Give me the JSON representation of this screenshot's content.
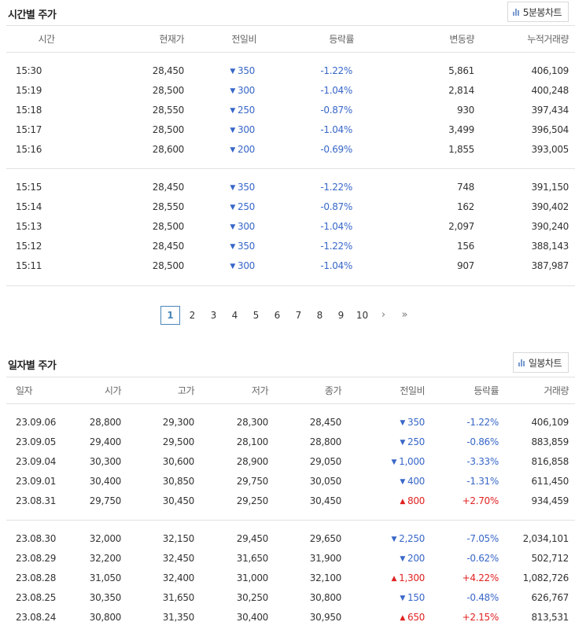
{
  "time_section": {
    "title": "시간별 주가",
    "chart_button": "5분봉차트",
    "headers": [
      "시간",
      "현재가",
      "전일비",
      "등락률",
      "변동량",
      "누적거래량"
    ],
    "groups": [
      [
        {
          "time": "15:30",
          "price": "28,450",
          "dir": "down",
          "change": "350",
          "rate": "-1.22%",
          "vol": "5,861",
          "cum": "406,109"
        },
        {
          "time": "15:19",
          "price": "28,500",
          "dir": "down",
          "change": "300",
          "rate": "-1.04%",
          "vol": "2,814",
          "cum": "400,248"
        },
        {
          "time": "15:18",
          "price": "28,550",
          "dir": "down",
          "change": "250",
          "rate": "-0.87%",
          "vol": "930",
          "cum": "397,434"
        },
        {
          "time": "15:17",
          "price": "28,500",
          "dir": "down",
          "change": "300",
          "rate": "-1.04%",
          "vol": "3,499",
          "cum": "396,504"
        },
        {
          "time": "15:16",
          "price": "28,600",
          "dir": "down",
          "change": "200",
          "rate": "-0.69%",
          "vol": "1,855",
          "cum": "393,005"
        }
      ],
      [
        {
          "time": "15:15",
          "price": "28,450",
          "dir": "down",
          "change": "350",
          "rate": "-1.22%",
          "vol": "748",
          "cum": "391,150"
        },
        {
          "time": "15:14",
          "price": "28,550",
          "dir": "down",
          "change": "250",
          "rate": "-0.87%",
          "vol": "162",
          "cum": "390,402"
        },
        {
          "time": "15:13",
          "price": "28,500",
          "dir": "down",
          "change": "300",
          "rate": "-1.04%",
          "vol": "2,097",
          "cum": "390,240"
        },
        {
          "time": "15:12",
          "price": "28,450",
          "dir": "down",
          "change": "350",
          "rate": "-1.22%",
          "vol": "156",
          "cum": "388,143"
        },
        {
          "time": "15:11",
          "price": "28,500",
          "dir": "down",
          "change": "300",
          "rate": "-1.04%",
          "vol": "907",
          "cum": "387,987"
        }
      ]
    ]
  },
  "pagination": {
    "pages": [
      "1",
      "2",
      "3",
      "4",
      "5",
      "6",
      "7",
      "8",
      "9",
      "10"
    ],
    "current": "1",
    "next": "›",
    "last": "»"
  },
  "daily_section": {
    "title": "일자별 주가",
    "chart_button": "일봉차트",
    "headers": [
      "일자",
      "시가",
      "고가",
      "저가",
      "종가",
      "전일비",
      "등락률",
      "거래량"
    ],
    "groups": [
      [
        {
          "date": "23.09.06",
          "open": "28,800",
          "high": "29,300",
          "low": "28,300",
          "close": "28,450",
          "dir": "down",
          "change": "350",
          "rate": "-1.22%",
          "volume": "406,109"
        },
        {
          "date": "23.09.05",
          "open": "29,400",
          "high": "29,500",
          "low": "28,100",
          "close": "28,800",
          "dir": "down",
          "change": "250",
          "rate": "-0.86%",
          "volume": "883,859"
        },
        {
          "date": "23.09.04",
          "open": "30,300",
          "high": "30,600",
          "low": "28,900",
          "close": "29,050",
          "dir": "down",
          "change": "1,000",
          "rate": "-3.33%",
          "volume": "816,858"
        },
        {
          "date": "23.09.01",
          "open": "30,400",
          "high": "30,850",
          "low": "29,750",
          "close": "30,050",
          "dir": "down",
          "change": "400",
          "rate": "-1.31%",
          "volume": "611,450"
        },
        {
          "date": "23.08.31",
          "open": "29,750",
          "high": "30,450",
          "low": "29,250",
          "close": "30,450",
          "dir": "up",
          "change": "800",
          "rate": "+2.70%",
          "volume": "934,459"
        }
      ],
      [
        {
          "date": "23.08.30",
          "open": "32,000",
          "high": "32,150",
          "low": "29,450",
          "close": "29,650",
          "dir": "down",
          "change": "2,250",
          "rate": "-7.05%",
          "volume": "2,034,101"
        },
        {
          "date": "23.08.29",
          "open": "32,200",
          "high": "32,450",
          "low": "31,650",
          "close": "31,900",
          "dir": "down",
          "change": "200",
          "rate": "-0.62%",
          "volume": "502,712"
        },
        {
          "date": "23.08.28",
          "open": "31,050",
          "high": "32,400",
          "low": "31,000",
          "close": "32,100",
          "dir": "up",
          "change": "1,300",
          "rate": "+4.22%",
          "volume": "1,082,726"
        },
        {
          "date": "23.08.25",
          "open": "30,350",
          "high": "31,650",
          "low": "30,250",
          "close": "30,800",
          "dir": "down",
          "change": "150",
          "rate": "-0.48%",
          "volume": "626,767"
        },
        {
          "date": "23.08.24",
          "open": "30,800",
          "high": "31,350",
          "low": "30,400",
          "close": "30,950",
          "dir": "up",
          "change": "650",
          "rate": "+2.15%",
          "volume": "813,531"
        }
      ]
    ]
  },
  "colors": {
    "down": "#3867c8",
    "up": "#e02222",
    "accent": "#4a86b8"
  },
  "icons": {
    "chart_button": "bar-chart-icon",
    "down": "triangle-down-icon",
    "up": "triangle-up-icon"
  }
}
